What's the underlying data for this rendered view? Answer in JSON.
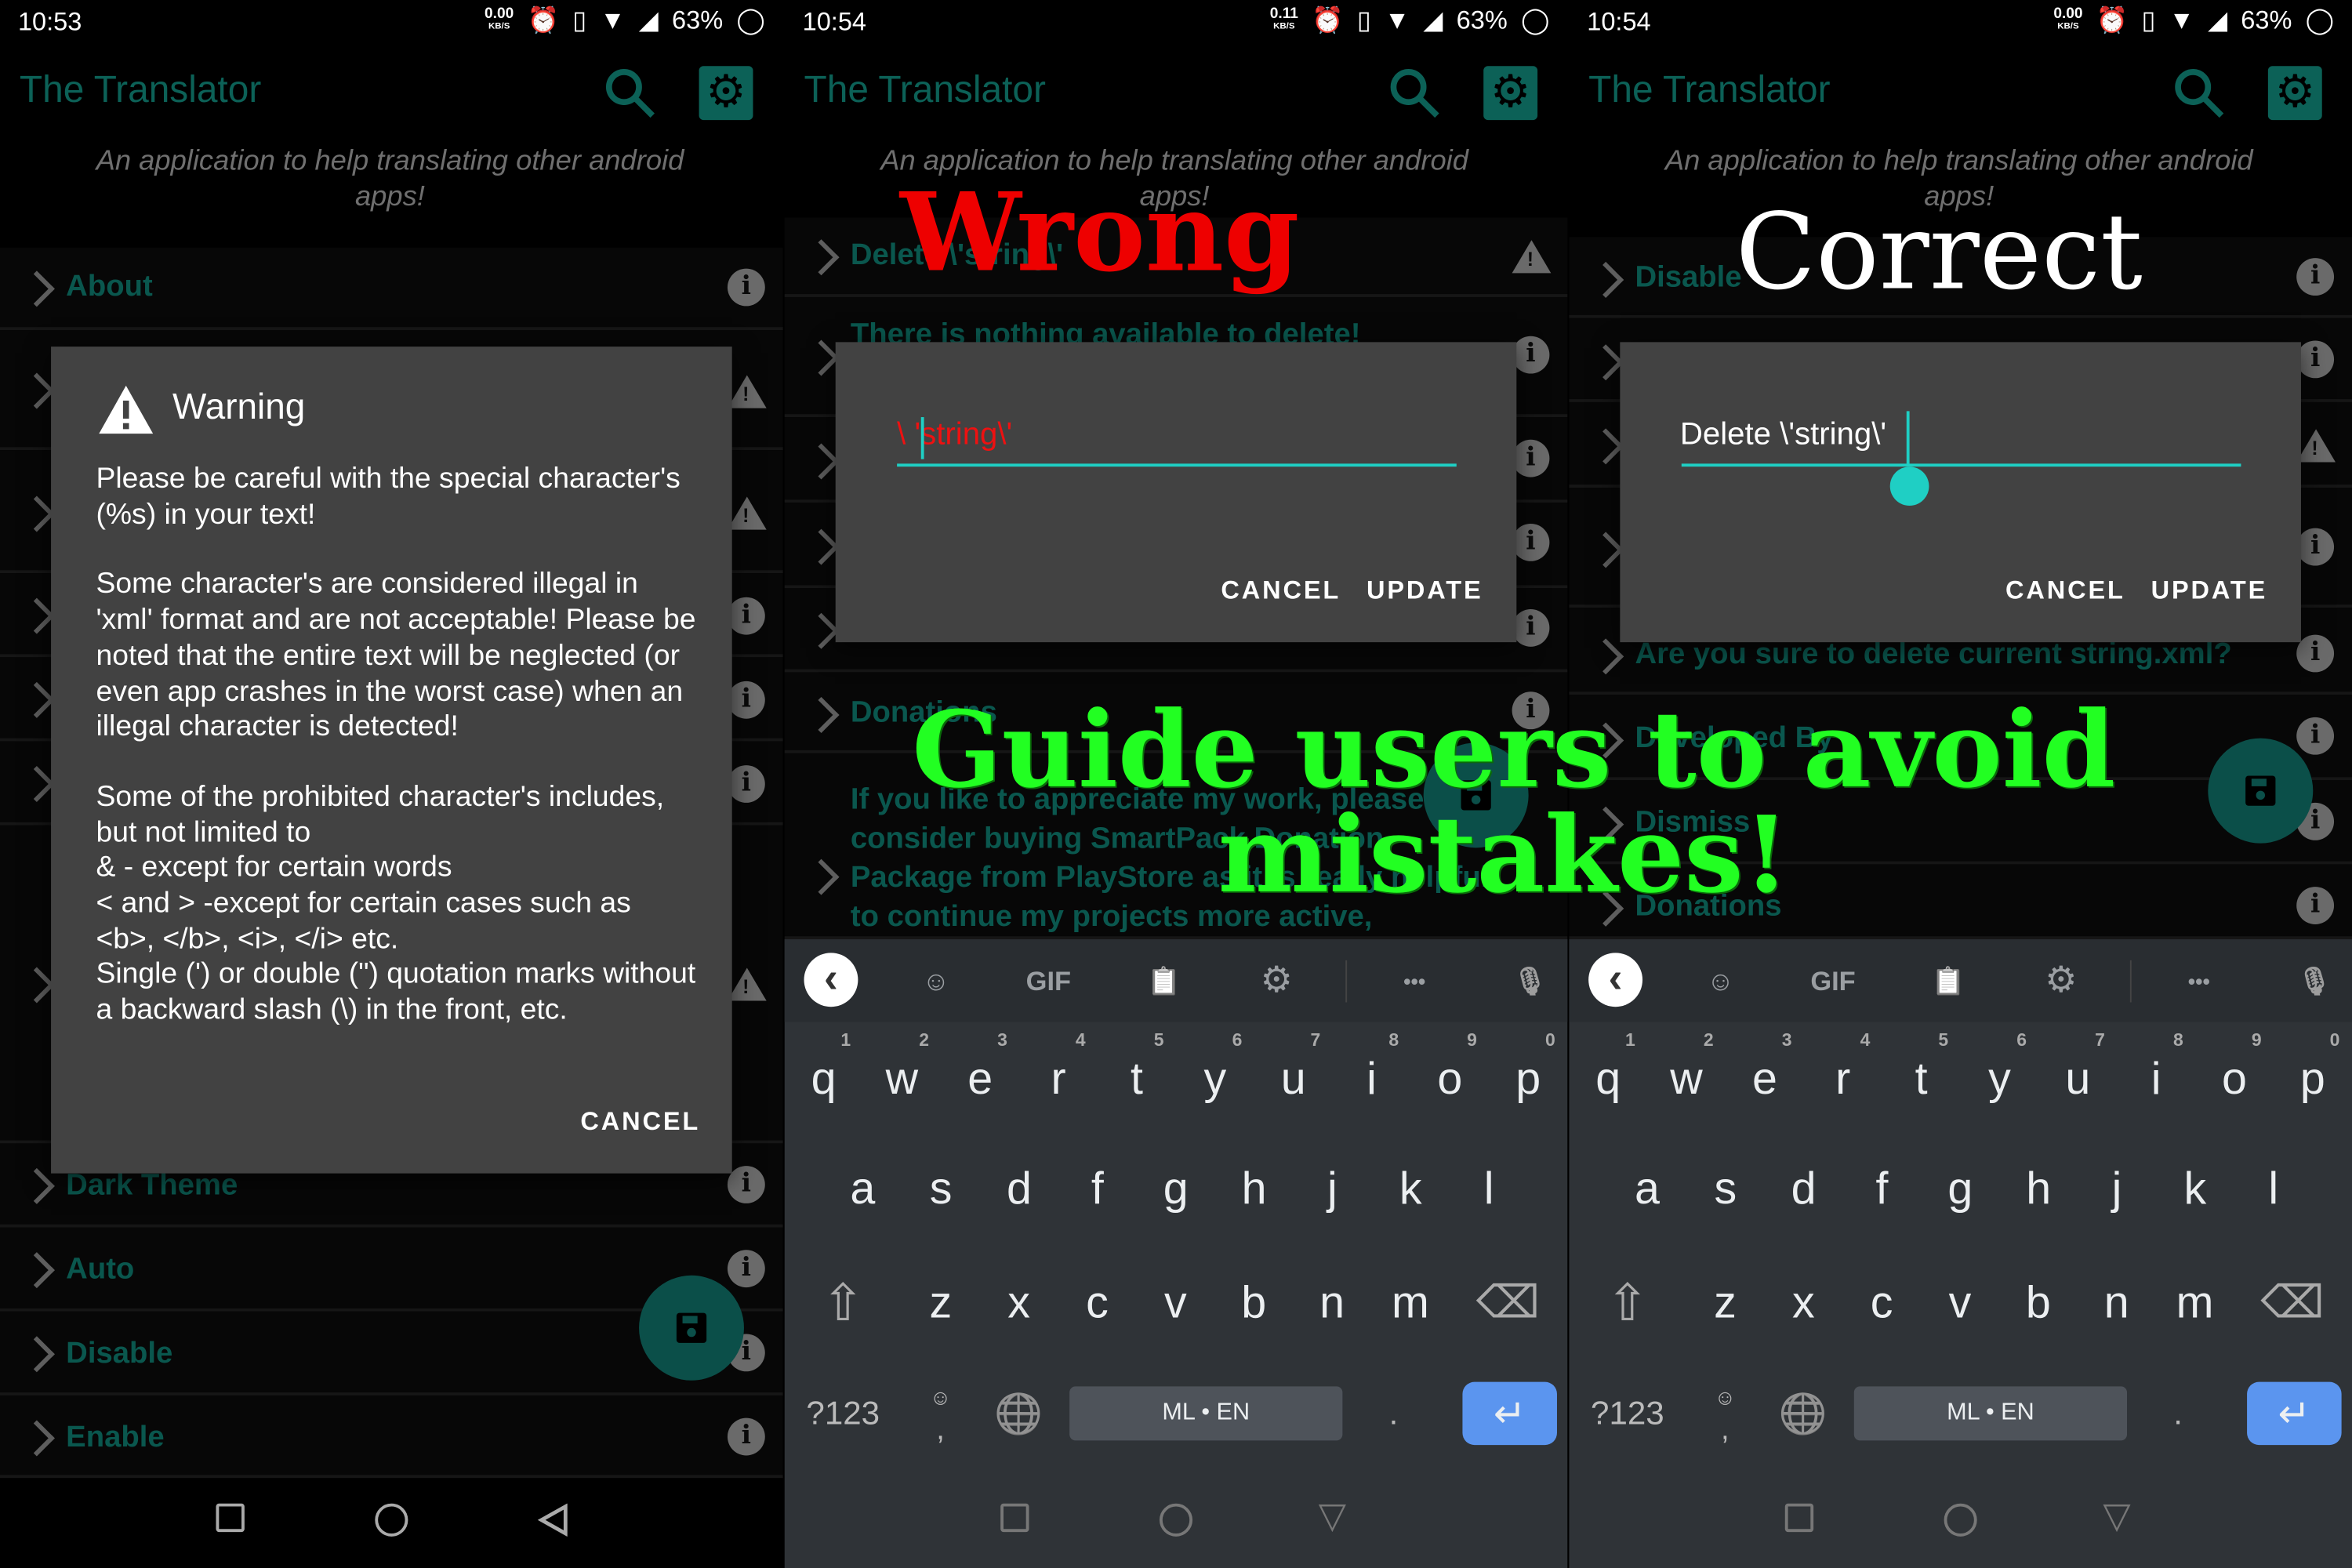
{
  "app": {
    "title": "The Translator",
    "subtitle": "An application to help translating other android apps!"
  },
  "panels": [
    {
      "status": {
        "time": "10:53",
        "speed": "0.00",
        "speed_unit": "KB/S",
        "battery": "63%"
      },
      "rows": {
        "about": "About",
        "dark_theme": "Dark Theme",
        "auto": "Auto",
        "disable": "Disable",
        "enable": "Enable"
      },
      "dialog": {
        "title": "Warning",
        "p1": "Please be careful with the special character's (%s) in your text!",
        "p2": "Some character's are considered illegal in 'xml' format and are not acceptable! Please be noted that the entire text will be neglected (or even app crashes in the worst case) when an illegal character is detected!",
        "p3_lines": [
          "Some of the prohibited character's includes, but not limited to",
          "& - except for certain words",
          "< and > -except for certain cases such as <b>, </b>, <i>, </i> etc.",
          "Single (') or double (\") quotation marks without a backward slash (\\) in the front, etc."
        ],
        "cancel": "CANCEL"
      }
    },
    {
      "status": {
        "time": "10:54",
        "speed": "0.11",
        "speed_unit": "KB/S",
        "battery": "63%"
      },
      "rows": {
        "delete_string": "Delete \\'string\\'",
        "nothing": "There is nothing available to delete!",
        "donations": "Donations",
        "donation_text": "If you like to appreciate my work, please consider buying SmartPack Donation Package from PlayStore as it is really helpful to continue my projects more active,"
      },
      "dialog": {
        "input_value": "\\ 'string\\'",
        "cancel": "CANCEL",
        "update": "UPDATE"
      }
    },
    {
      "status": {
        "time": "10:54",
        "speed": "0.00",
        "speed_unit": "KB/S",
        "battery": "63%"
      },
      "rows": {
        "disable": "Disable",
        "are_you_sure": "Are you sure to delete current string.xml?",
        "developed_by": "Developed By",
        "dismiss": "Dismiss",
        "donations": "Donations"
      },
      "dialog": {
        "input_value": "Delete \\'string\\'",
        "cancel": "CANCEL",
        "update": "UPDATE"
      }
    }
  ],
  "keyboard": {
    "toolbar": {
      "gif": "GIF"
    },
    "row1": [
      "q",
      "w",
      "e",
      "r",
      "t",
      "y",
      "u",
      "i",
      "o",
      "p"
    ],
    "row1_hints": [
      "1",
      "2",
      "3",
      "4",
      "5",
      "6",
      "7",
      "8",
      "9",
      "0"
    ],
    "row2": [
      "a",
      "s",
      "d",
      "f",
      "g",
      "h",
      "j",
      "k",
      "l"
    ],
    "row3": [
      "z",
      "x",
      "c",
      "v",
      "b",
      "n",
      "m"
    ],
    "symbols": "?123",
    "comma": ",",
    "space_label": "ML • EN",
    "period": "."
  },
  "annotations": {
    "wrong": "Wrong",
    "correct": "Correct",
    "guide_line1": "Guide users to avoid",
    "guide_line2": "mistakes!"
  },
  "colors": {
    "accent": "#0c6157",
    "cursor": "#1fcfc4",
    "wrong": "#ee0000",
    "guide": "#22ff22",
    "enter": "#5b95ef"
  }
}
